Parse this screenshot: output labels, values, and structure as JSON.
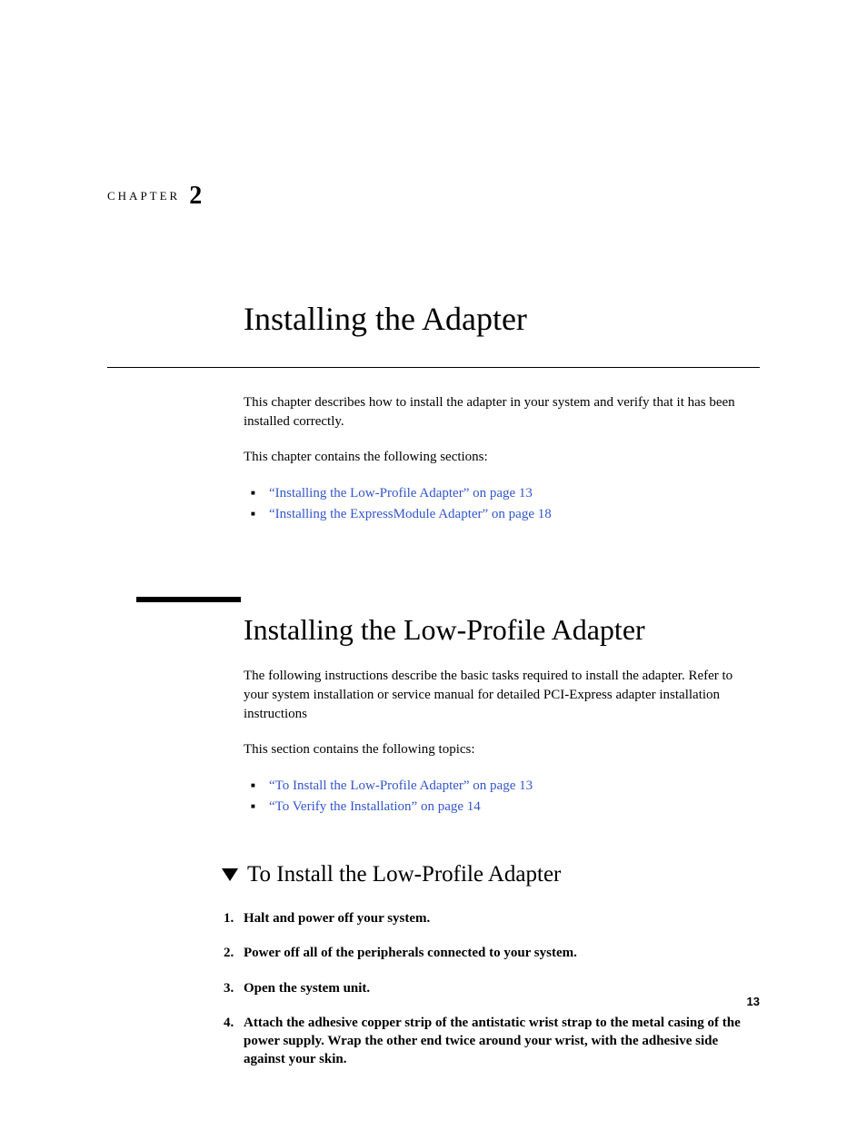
{
  "chapter": {
    "label": "CHAPTER",
    "number": "2",
    "title": "Installing the Adapter"
  },
  "intro": {
    "para1": "This chapter describes how to install the adapter in your system and verify that it has been installed correctly.",
    "para2": "This chapter contains the following sections:",
    "links": [
      "“Installing the Low-Profile Adapter” on page 13",
      "“Installing the ExpressModule Adapter” on page 18"
    ]
  },
  "section": {
    "title": "Installing the Low-Profile Adapter",
    "para1": "The following instructions describe the basic tasks required to install the adapter. Refer to your system installation or service manual for detailed PCI-Express adapter installation instructions",
    "para2": "This section contains the following topics:",
    "links": [
      "“To Install the Low-Profile Adapter” on page 13",
      "“To Verify the Installation” on page 14"
    ]
  },
  "subsection": {
    "title": "To Install the Low-Profile Adapter",
    "steps": [
      "Halt and power off your system.",
      "Power off all of the peripherals connected to your system.",
      "Open the system unit.",
      "Attach the adhesive copper strip of the antistatic wrist strap to the metal casing of the power supply. Wrap the other end twice around your wrist, with the adhesive side against your skin."
    ]
  },
  "page_number": "13"
}
